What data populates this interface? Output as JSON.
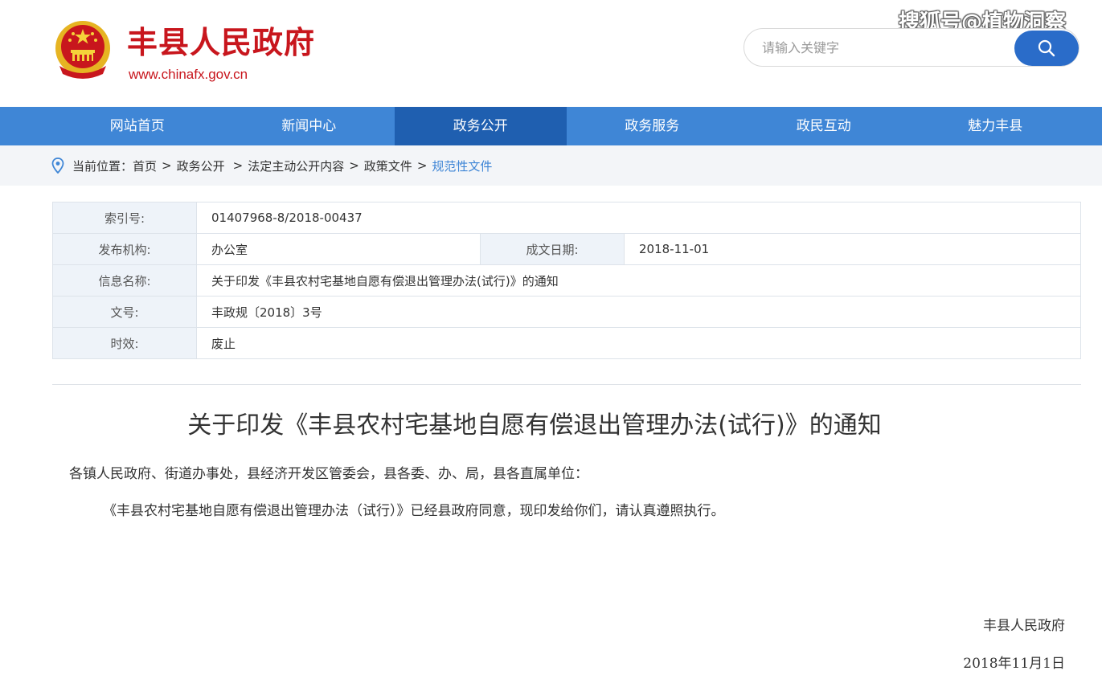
{
  "header": {
    "site_title": "丰县人民政府",
    "site_url": "www.chinafx.gov.cn",
    "watermark": "搜狐号@植物洞察",
    "search_placeholder": "请输入关键字"
  },
  "colors": {
    "brand_red": "#c8161d",
    "nav_blue": "#3f86d6",
    "nav_active": "#1f5fb0",
    "search_button": "#2a6cc9"
  },
  "nav": {
    "items": [
      {
        "label": "网站首页"
      },
      {
        "label": "新闻中心"
      },
      {
        "label": "政务公开",
        "active": true
      },
      {
        "label": "政务服务"
      },
      {
        "label": "政民互动"
      },
      {
        "label": "魅力丰县"
      }
    ]
  },
  "breadcrumb": {
    "prefix": "当前位置：",
    "items": [
      "首页",
      "政务公开",
      "法定主动公开内容",
      "政策文件"
    ],
    "current": "规范性文件"
  },
  "info": {
    "index_label": "索引号:",
    "index_value": "01407968-8/2018-00437",
    "publisher_label": "发布机构:",
    "publisher_value": "办公室",
    "date_label": "成文日期:",
    "date_value": "2018-11-01",
    "name_label": "信息名称:",
    "name_value": "关于印发《丰县农村宅基地自愿有偿退出管理办法(试行)》的通知",
    "docno_label": "文号:",
    "docno_value": "丰政规〔2018〕3号",
    "status_label": "时效:",
    "status_value": "废止"
  },
  "article": {
    "title": "关于印发《丰县农村宅基地自愿有偿退出管理办法(试行)》的通知",
    "recipients": "各镇人民政府、街道办事处，县经济开发区管委会，县各委、办、局，县各直属单位：",
    "body": "《丰县农村宅基地自愿有偿退出管理办法（试行）》已经县政府同意，现印发给你们，请认真遵照执行。",
    "signatory": "丰县人民政府",
    "sign_date": "2018年11月1日"
  }
}
